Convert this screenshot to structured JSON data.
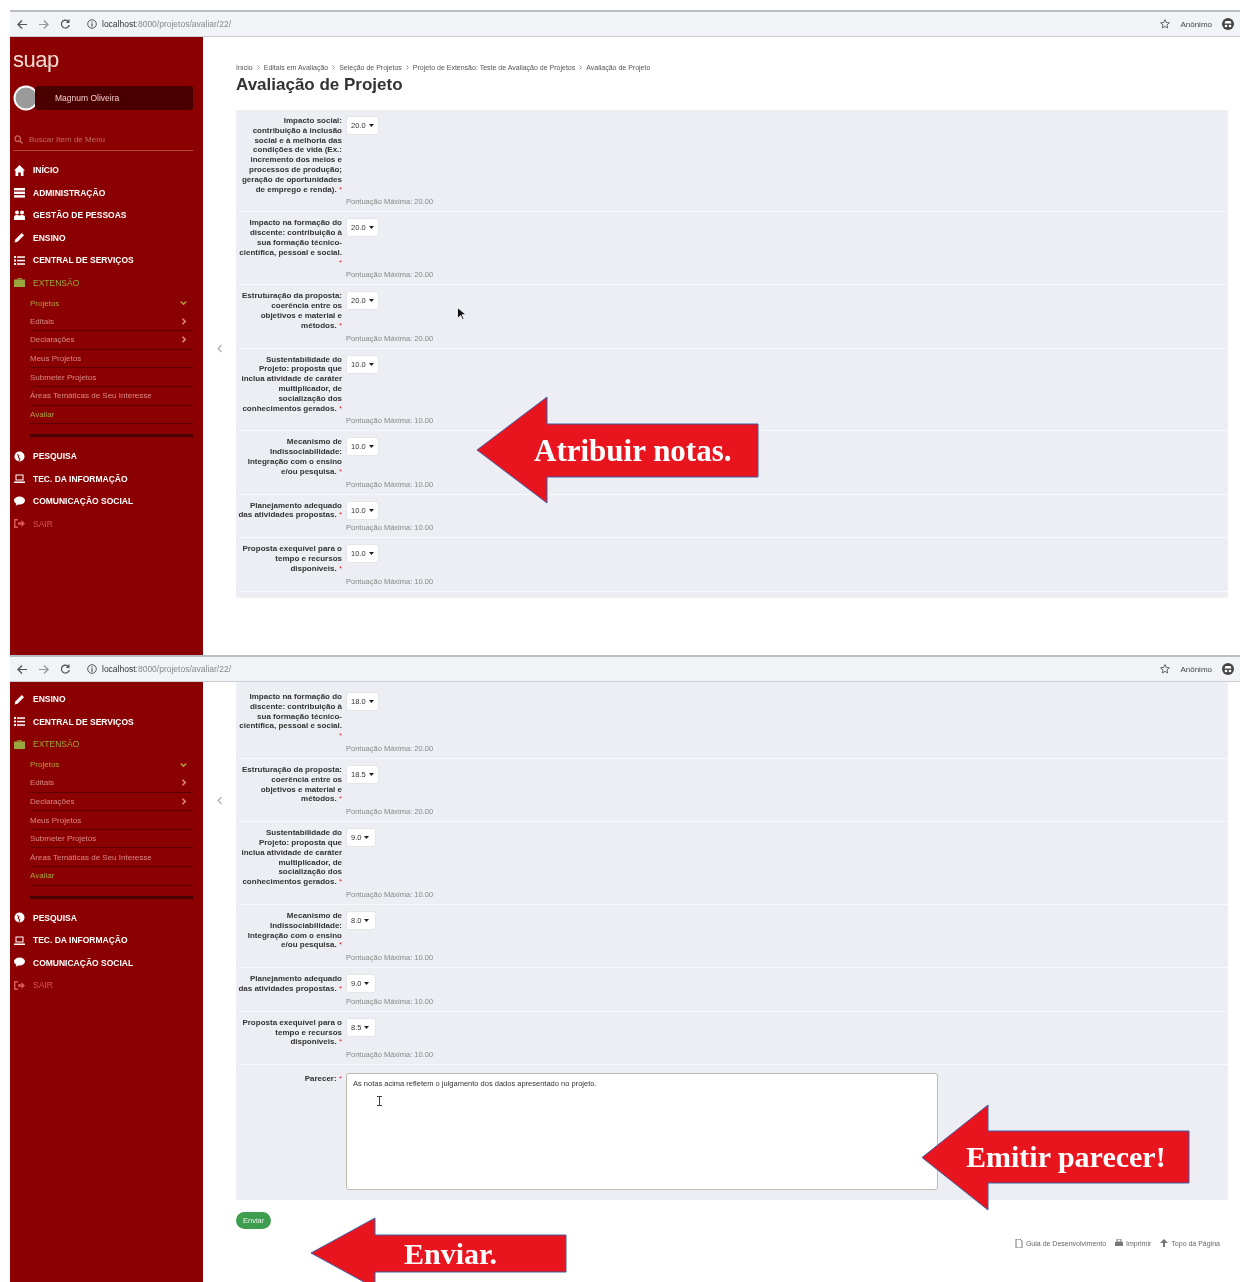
{
  "panels": [
    {
      "browser": {
        "url_host": "localhost",
        "url_path": ":8000/projetos/avaliar/22/",
        "profile": "Anônimo"
      },
      "sidebar": {
        "logo": "suap",
        "user": "Magnum Oliveira",
        "search_placeholder": "Buscar Item de Menu",
        "items": [
          {
            "label": "INÍCIO",
            "kind": "link",
            "selected": false
          },
          {
            "label": "ADMINISTRAÇÃO",
            "kind": "link",
            "selected": false
          },
          {
            "label": "GESTÃO DE PESSOAS",
            "kind": "link",
            "selected": false
          },
          {
            "label": "ENSINO",
            "kind": "link",
            "selected": false
          },
          {
            "label": "CENTRAL DE SERVIÇOS",
            "kind": "link",
            "selected": false
          },
          {
            "label": "EXTENSÃO",
            "kind": "link",
            "selected": true,
            "children": [
              {
                "label": "Projetos",
                "selected": true,
                "expanded": true,
                "children": [
                  {
                    "label": "Editais",
                    "selected": false,
                    "expanded": false
                  },
                  {
                    "label": "Declarações",
                    "selected": false,
                    "expanded": false
                  },
                  {
                    "label": "Meus Projetos",
                    "selected": false
                  },
                  {
                    "label": "Submeter Projetos",
                    "selected": false
                  },
                  {
                    "label": "Áreas Temáticas de Seu Interesse",
                    "selected": false
                  },
                  {
                    "label": "Avaliar",
                    "selected": true
                  }
                ]
              }
            ]
          },
          {
            "label": "PESQUISA",
            "kind": "link",
            "selected": false
          },
          {
            "label": "TEC. DA INFORMAÇÃO",
            "kind": "link",
            "selected": false
          },
          {
            "label": "COMUNICAÇÃO SOCIAL",
            "kind": "link",
            "selected": false
          },
          {
            "label": "SAIR",
            "kind": "logout",
            "selected": false
          }
        ]
      },
      "breadcrumb": [
        "Início",
        "Editais em Avaliação",
        "Seleção de Projetos",
        "Projeto de Extensão: Teste de Avaliação de Projetos",
        "Avaliação de Projeto"
      ],
      "title": "Avaliação de Projeto",
      "criteria": [
        {
          "label": "Impacto social: contribuição à inclusão social e à melhoria das condições de vida (Ex.: incremento dos meios e processos de produção; geração de oportunidades de emprego e renda).",
          "required": "*",
          "value": "20.0",
          "max": "Pontuação Máxima: 20.00"
        },
        {
          "label": "Impacto na formação do discente: contribuição à sua formação técnico-científica, pessoal e social.",
          "required": "*",
          "value": "20.0",
          "max": "Pontuação Máxima: 20.00"
        },
        {
          "label": "Estruturação da proposta: coerência entre os objetivos e material e métodos.",
          "required": "*",
          "value": "20.0",
          "max": "Pontuação Máxima: 20.00"
        },
        {
          "label": "Sustentabilidade do Projeto: proposta que inclua atividade de caráter multiplicador, de socialização dos conhecimentos gerados.",
          "required": "*",
          "value": "10.0",
          "max": "Pontuação Máxima: 10.00"
        },
        {
          "label": "Mecanismo de Indissociabilidade: Integração com o ensino e/ou pesquisa.",
          "required": "*",
          "value": "10.0",
          "max": "Pontuação Máxima: 10.00"
        },
        {
          "label": "Planejamento adequado das atividades propostas.",
          "required": "*",
          "value": "10.0",
          "max": "Pontuação Máxima: 10.00"
        },
        {
          "label": "Proposta exequível para o tempo e recursos disponíveis.",
          "required": "*",
          "value": "10.0",
          "max": "Pontuação Máxima: 10.00"
        }
      ],
      "callouts": [
        {
          "text": "Atribuir notas."
        }
      ]
    },
    {
      "browser": {
        "url_host": "localhost",
        "url_path": ":8000/projetos/avaliar/22/",
        "profile": "Anônimo"
      },
      "sidebar": {
        "items": [
          {
            "label": "ENSINO",
            "kind": "link",
            "selected": false
          },
          {
            "label": "CENTRAL DE SERVIÇOS",
            "kind": "link",
            "selected": false
          },
          {
            "label": "EXTENSÃO",
            "kind": "link",
            "selected": true,
            "children": [
              {
                "label": "Projetos",
                "selected": true,
                "expanded": true,
                "children": [
                  {
                    "label": "Editais",
                    "selected": false,
                    "expanded": false
                  },
                  {
                    "label": "Declarações",
                    "selected": false,
                    "expanded": false
                  },
                  {
                    "label": "Meus Projetos",
                    "selected": false
                  },
                  {
                    "label": "Submeter Projetos",
                    "selected": false
                  },
                  {
                    "label": "Áreas Temáticas de Seu Interesse",
                    "selected": false
                  },
                  {
                    "label": "Avaliar",
                    "selected": true
                  }
                ]
              }
            ]
          },
          {
            "label": "PESQUISA",
            "kind": "link",
            "selected": false
          },
          {
            "label": "TEC. DA INFORMAÇÃO",
            "kind": "link",
            "selected": false
          },
          {
            "label": "COMUNICAÇÃO SOCIAL",
            "kind": "link",
            "selected": false
          },
          {
            "label": "SAIR",
            "kind": "logout",
            "selected": false
          }
        ]
      },
      "criteria": [
        {
          "label": "Impacto na formação do discente: contribuição à sua formação técnico-científica, pessoal e social.",
          "required": "*",
          "value": "18.0",
          "max": "Pontuação Máxima: 20.00"
        },
        {
          "label": "Estruturação da proposta: coerência entre os objetivos e material e métodos.",
          "required": "*",
          "value": "18.5",
          "max": "Pontuação Máxima: 20.00"
        },
        {
          "label": "Sustentabilidade do Projeto: proposta que inclua atividade de caráter multiplicador, de socialização dos conhecimentos gerados.",
          "required": "*",
          "value": "9.0",
          "max": "Pontuação Máxima: 10.00"
        },
        {
          "label": "Mecanismo de Indissociabilidade: Integração com o ensino e/ou pesquisa.",
          "required": "*",
          "value": "8.0",
          "max": "Pontuação Máxima: 10.00"
        },
        {
          "label": "Planejamento adequado das atividades propostas.",
          "required": "*",
          "value": "9.0",
          "max": "Pontuação Máxima: 10.00"
        },
        {
          "label": "Proposta exequível para o tempo e recursos disponíveis.",
          "required": "*",
          "value": "8.5",
          "max": "Pontuação Máxima: 10.00"
        }
      ],
      "opinion": {
        "label": "Parecer:",
        "required": "*",
        "value": "As notas acima refletem o julgamento dos dados apresentado no projeto."
      },
      "submit": "Enviar",
      "footer_links": [
        "Guia de Desenvolvimento",
        "Imprimir",
        "Topo da Página"
      ],
      "callouts": [
        {
          "text": "Emitir parecer!"
        },
        {
          "text": "Enviar."
        }
      ]
    }
  ]
}
